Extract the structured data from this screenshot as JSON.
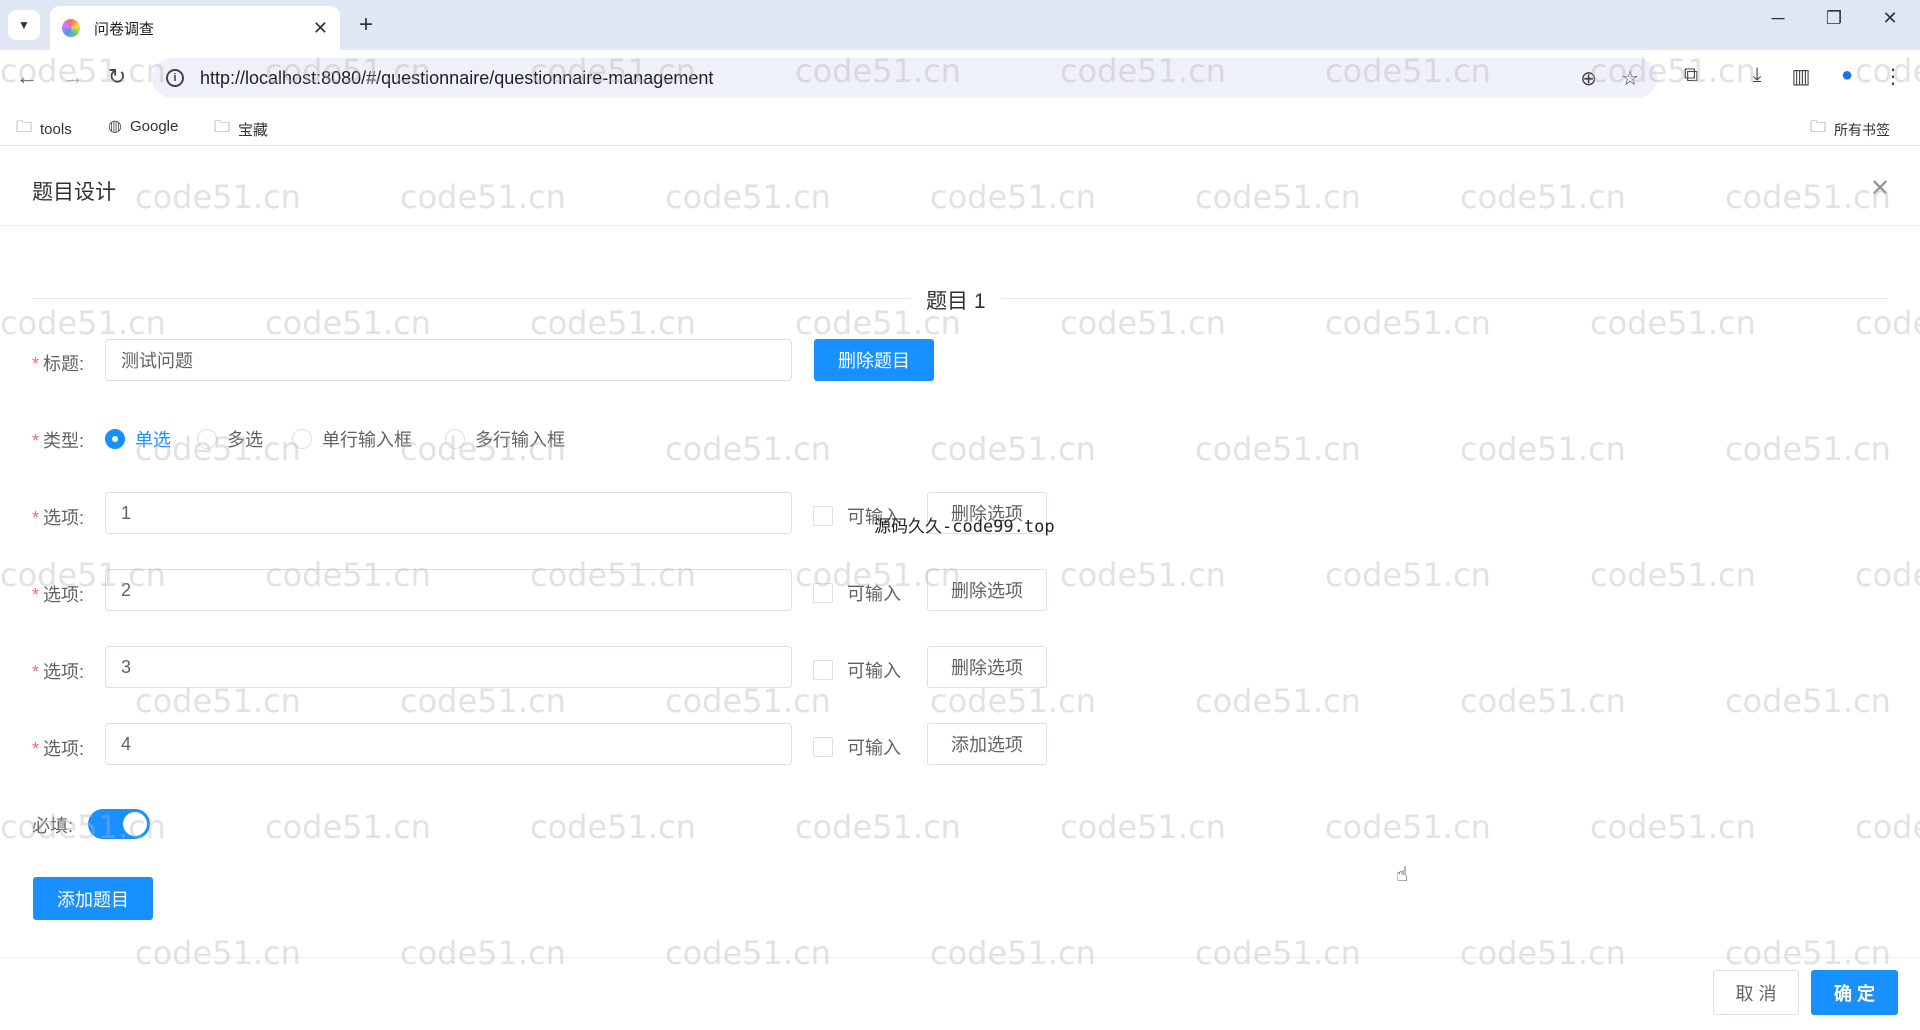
{
  "browser": {
    "tab_title": "问卷调查",
    "tab_close": "✕",
    "new_tab": "+",
    "url": "http://localhost:8080/#/questionnaire/questionnaire-management",
    "bookmarks": [
      {
        "label": "tools"
      },
      {
        "label": "Google"
      },
      {
        "label": "宝藏"
      }
    ],
    "all_bookmarks": "所有书签"
  },
  "dialog": {
    "title": "题目设计",
    "close": "✕",
    "divider_label": "题目 1",
    "title_label": "标题:",
    "title_value": "测试问题",
    "delete_question": "删除题目",
    "type_label": "类型:",
    "types": [
      {
        "label": "单选",
        "checked": true
      },
      {
        "label": "多选",
        "checked": false
      },
      {
        "label": "单行输入框",
        "checked": false
      },
      {
        "label": "多行输入框",
        "checked": false
      }
    ],
    "option_label": "选项:",
    "options": [
      {
        "value": "1",
        "checkbox_label": "可输入",
        "action": "删除选项"
      },
      {
        "value": "2",
        "checkbox_label": "可输入",
        "action": "删除选项"
      },
      {
        "value": "3",
        "checkbox_label": "可输入",
        "action": "删除选项"
      },
      {
        "value": "4",
        "checkbox_label": "可输入",
        "action": "添加选项"
      }
    ],
    "required_label": "必填:",
    "required_on": true,
    "add_question": "添加题目",
    "cancel": "取 消",
    "confirm": "确 定"
  },
  "watermark": "code51.cn",
  "overlay_text": "源码久久-code99.top"
}
